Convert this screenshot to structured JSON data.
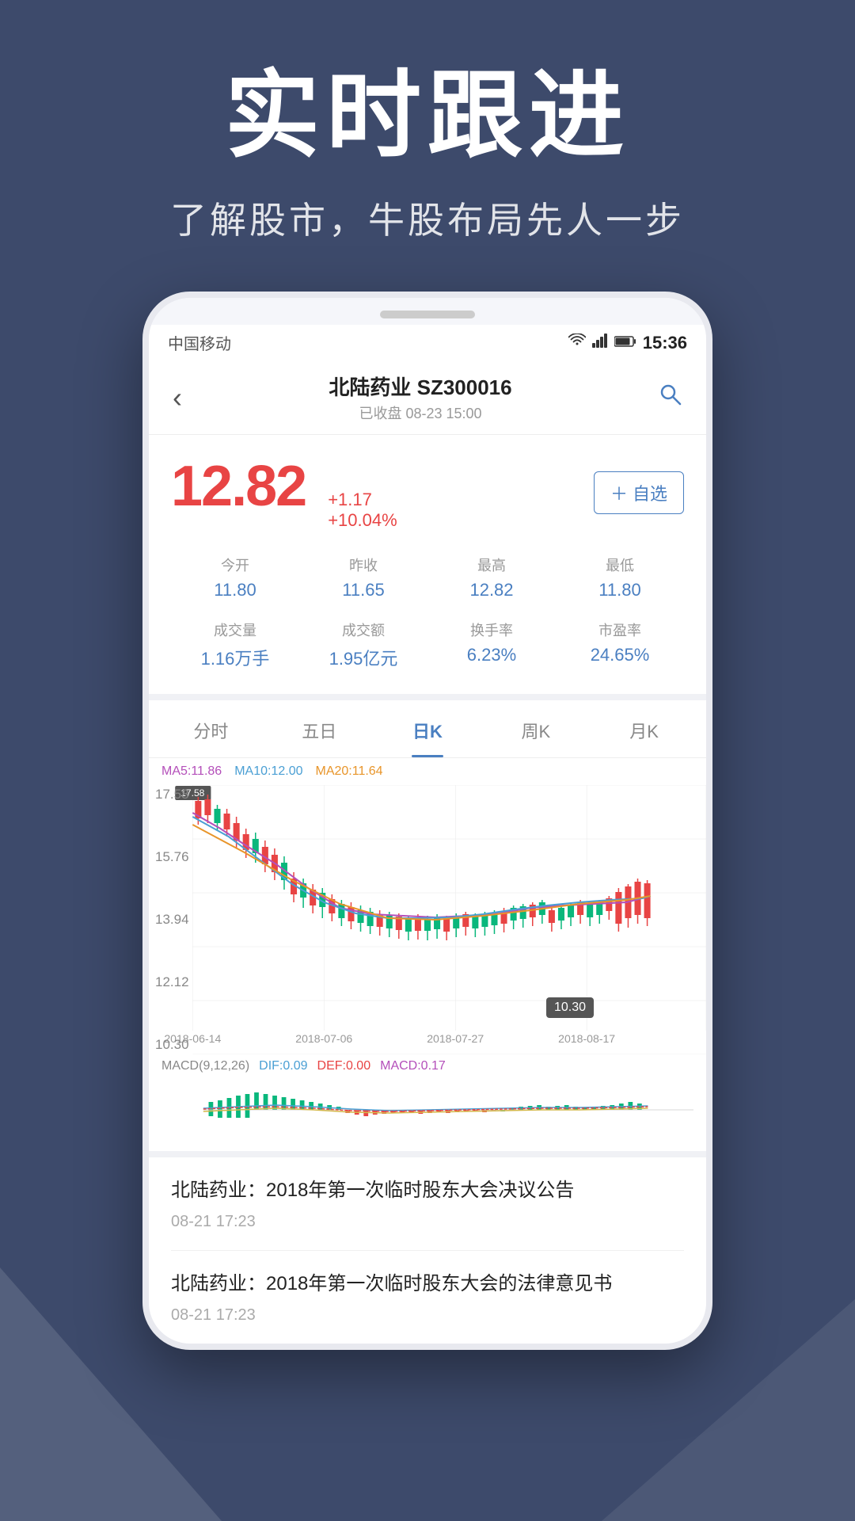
{
  "background": {
    "color": "#3d4a6b"
  },
  "hero": {
    "main_title": "实时跟进",
    "sub_title": "了解股市，牛股布局先人一步"
  },
  "phone": {
    "status_bar": {
      "carrier": "中国移动",
      "time": "15:36"
    },
    "nav": {
      "back_label": "‹",
      "stock_name": "北陆药业 SZ300016",
      "stock_time": "已收盘 08-23 15:00",
      "search_label": "🔍"
    },
    "price": {
      "current": "12.82",
      "change_abs": "+1.17",
      "change_pct": "+10.04%",
      "watchlist_label": "+自选",
      "stats": [
        {
          "label": "今开",
          "value": "11.80"
        },
        {
          "label": "昨收",
          "value": "11.65"
        },
        {
          "label": "最高",
          "value": "12.82"
        },
        {
          "label": "最低",
          "value": "11.80"
        },
        {
          "label": "成交量",
          "value": "1.16万手"
        },
        {
          "label": "成交额",
          "value": "1.95亿元"
        },
        {
          "label": "换手率",
          "value": "6.23%"
        },
        {
          "label": "市盈率",
          "value": "24.65%"
        }
      ]
    },
    "chart_tabs": [
      {
        "label": "分时",
        "active": false
      },
      {
        "label": "五日",
        "active": false
      },
      {
        "label": "日K",
        "active": true
      },
      {
        "label": "周K",
        "active": false
      },
      {
        "label": "月K",
        "active": false
      }
    ],
    "ma_indicators": {
      "ma5": "MA5:11.86",
      "ma10": "MA10:12.00",
      "ma20": "MA20:11.64"
    },
    "chart_y_labels": [
      "17.58",
      "15.76",
      "13.94",
      "12.12",
      "10.30"
    ],
    "chart_x_labels": [
      "2018-06-14",
      "2018-07-06",
      "2018-07-27",
      "2018-08-17"
    ],
    "chart_tooltip": "10.30",
    "macd": {
      "label": "MACD(9,12,26)",
      "dif": "DIF:0.09",
      "def": "DEF:0.00",
      "macd": "MACD:0.17"
    },
    "news": [
      {
        "title": "北陆药业：2018年第一次临时股东大会决议公告",
        "time": "08-21 17:23"
      },
      {
        "title": "北陆药业：2018年第一次临时股东大会的法律意见书",
        "time": "08-21 17:23"
      }
    ]
  }
}
